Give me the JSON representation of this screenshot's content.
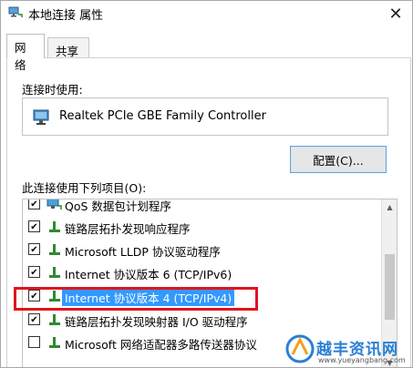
{
  "window": {
    "title": "本地连接 属性",
    "close_glyph": "✕"
  },
  "tabs": [
    {
      "label": "网络",
      "active": true
    },
    {
      "label": "共享",
      "active": false
    }
  ],
  "connection": {
    "label": "连接时使用:",
    "adapter_name": "Realtek PCIe GBE Family Controller",
    "adapter_icon": "network-adapter-icon"
  },
  "config_button": {
    "label": "配置(C)..."
  },
  "items": {
    "label": "此连接使用下列项目(O):",
    "list": [
      {
        "label": "QoS 数据包计划程序",
        "checked": true,
        "icon": "qos-icon"
      },
      {
        "label": "链路层拓扑发现响应程序",
        "checked": true,
        "icon": "protocol-icon"
      },
      {
        "label": "Microsoft LLDP 协议驱动程序",
        "checked": true,
        "icon": "protocol-icon"
      },
      {
        "label": "Internet 协议版本 6 (TCP/IPv6)",
        "checked": true,
        "icon": "protocol-icon"
      },
      {
        "label": "Internet 协议版本 4 (TCP/IPv4)",
        "checked": true,
        "icon": "protocol-icon",
        "selected": true
      },
      {
        "label": "链路层拓扑发现映射器 I/O 驱动程序",
        "checked": true,
        "icon": "protocol-icon"
      },
      {
        "label": "Microsoft 网络适配器多路传送器协议",
        "checked": false,
        "icon": "protocol-icon"
      }
    ]
  },
  "watermark": {
    "text": "越丰资讯网",
    "url": "www.yueyangbang.com"
  },
  "colors": {
    "selection": "#3399ff",
    "highlight_border": "#e0141e",
    "button_border": "#6f9fd6"
  }
}
